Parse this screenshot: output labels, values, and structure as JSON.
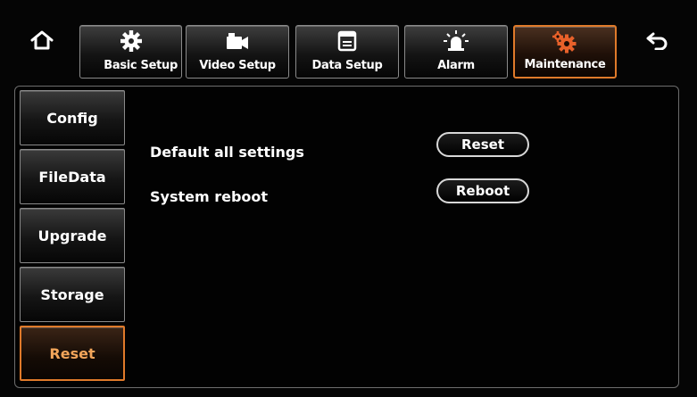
{
  "toolbar": {
    "home_icon": "home-icon",
    "back_icon": "back-arrow-icon",
    "tabs": [
      {
        "label": "Basic Setup",
        "icon": "gear-icon"
      },
      {
        "label": "Video Setup",
        "icon": "camera-icon"
      },
      {
        "label": "Data Setup",
        "icon": "data-window-icon"
      },
      {
        "label": "Alarm",
        "icon": "alarm-light-icon"
      },
      {
        "label": "Maintenance",
        "icon": "maintenance-gears-icon"
      }
    ],
    "active_tab": "Maintenance"
  },
  "sidebar": {
    "items": [
      {
        "label": "Config"
      },
      {
        "label": "FileData"
      },
      {
        "label": "Upgrade"
      },
      {
        "label": "Storage"
      },
      {
        "label": "Reset"
      }
    ],
    "active_item": "Reset"
  },
  "content": {
    "rows": [
      {
        "label": "Default all settings",
        "button": "Reset"
      },
      {
        "label": "System reboot",
        "button": "Reboot"
      }
    ]
  },
  "colors": {
    "accent": "#e07a2a",
    "background": "#050505",
    "border": "#8a8a8a"
  }
}
